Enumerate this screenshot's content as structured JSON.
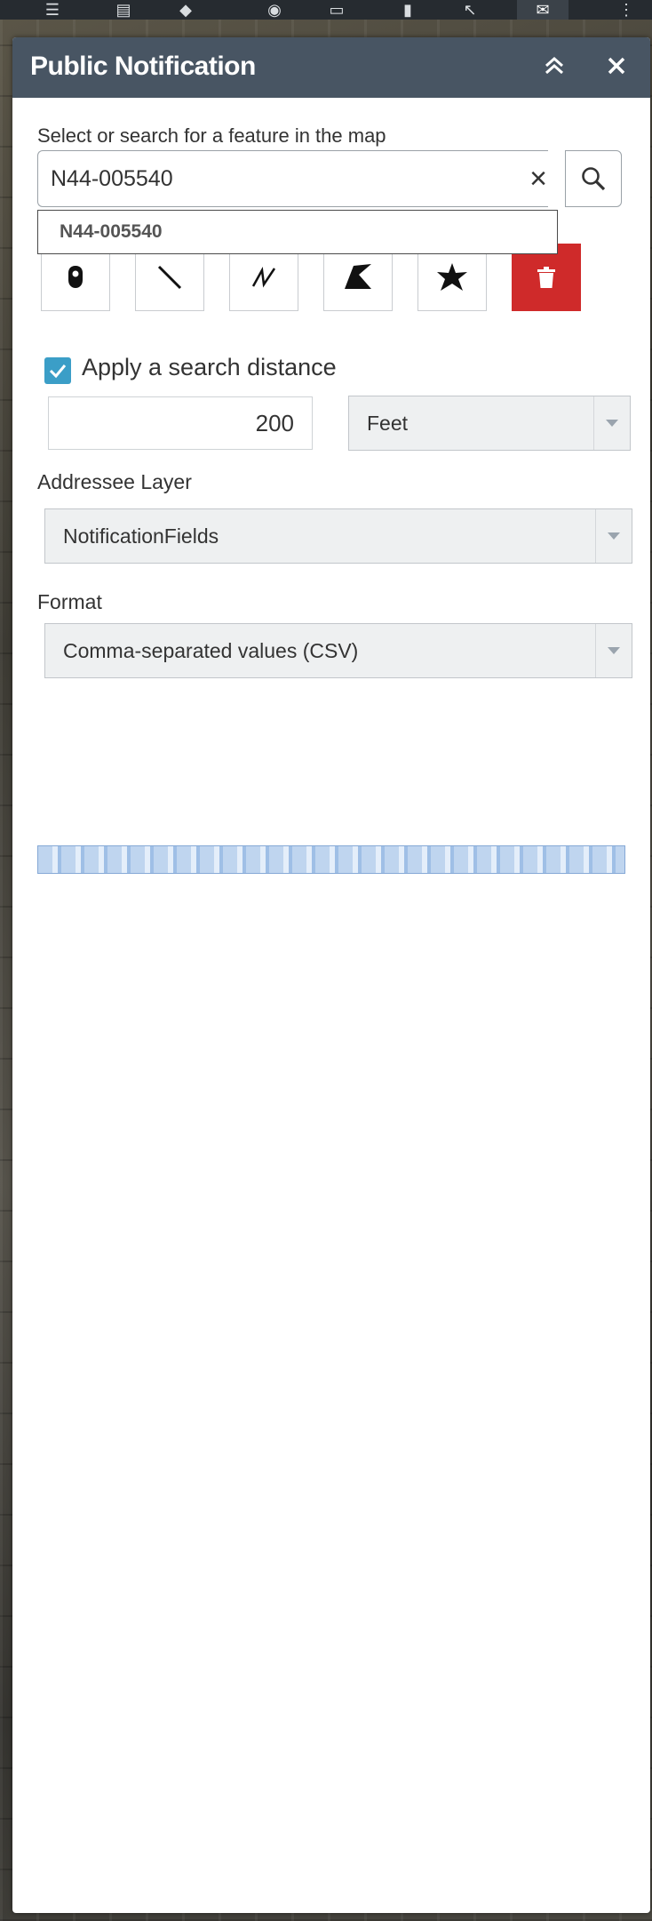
{
  "panel": {
    "title": "Public Notification",
    "feature_label": "Select or search for a feature in the map",
    "search_value": "N44-005540",
    "clear_symbol": "×",
    "suggestion": "N44-005540",
    "draw_tools": [
      "point-icon",
      "line-icon",
      "polyline-icon",
      "freehand-polygon-icon",
      "star-icon",
      "trash-icon"
    ],
    "apply_distance_label": "Apply a search distance",
    "apply_distance_checked": true,
    "distance_value": "200",
    "distance_unit": "Feet",
    "addressee_label": "Addressee Layer",
    "addressee_value": "NotificationFields",
    "format_label": "Format",
    "format_value": "Comma-separated values (CSV)"
  },
  "colors": {
    "header": "#485563",
    "delete": "#cf2a2a",
    "checkbox": "#3b9ec7"
  }
}
